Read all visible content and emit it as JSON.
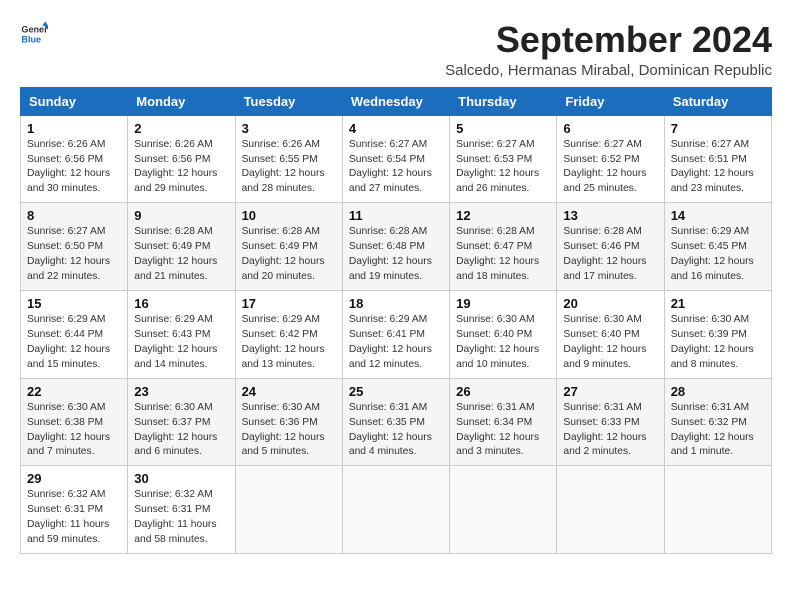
{
  "logo": {
    "line1": "General",
    "line2": "Blue"
  },
  "title": "September 2024",
  "subtitle": "Salcedo, Hermanas Mirabal, Dominican Republic",
  "headers": [
    "Sunday",
    "Monday",
    "Tuesday",
    "Wednesday",
    "Thursday",
    "Friday",
    "Saturday"
  ],
  "weeks": [
    [
      {
        "day": "1",
        "text": "Sunrise: 6:26 AM\nSunset: 6:56 PM\nDaylight: 12 hours\nand 30 minutes."
      },
      {
        "day": "2",
        "text": "Sunrise: 6:26 AM\nSunset: 6:56 PM\nDaylight: 12 hours\nand 29 minutes."
      },
      {
        "day": "3",
        "text": "Sunrise: 6:26 AM\nSunset: 6:55 PM\nDaylight: 12 hours\nand 28 minutes."
      },
      {
        "day": "4",
        "text": "Sunrise: 6:27 AM\nSunset: 6:54 PM\nDaylight: 12 hours\nand 27 minutes."
      },
      {
        "day": "5",
        "text": "Sunrise: 6:27 AM\nSunset: 6:53 PM\nDaylight: 12 hours\nand 26 minutes."
      },
      {
        "day": "6",
        "text": "Sunrise: 6:27 AM\nSunset: 6:52 PM\nDaylight: 12 hours\nand 25 minutes."
      },
      {
        "day": "7",
        "text": "Sunrise: 6:27 AM\nSunset: 6:51 PM\nDaylight: 12 hours\nand 23 minutes."
      }
    ],
    [
      {
        "day": "8",
        "text": "Sunrise: 6:27 AM\nSunset: 6:50 PM\nDaylight: 12 hours\nand 22 minutes."
      },
      {
        "day": "9",
        "text": "Sunrise: 6:28 AM\nSunset: 6:49 PM\nDaylight: 12 hours\nand 21 minutes."
      },
      {
        "day": "10",
        "text": "Sunrise: 6:28 AM\nSunset: 6:49 PM\nDaylight: 12 hours\nand 20 minutes."
      },
      {
        "day": "11",
        "text": "Sunrise: 6:28 AM\nSunset: 6:48 PM\nDaylight: 12 hours\nand 19 minutes."
      },
      {
        "day": "12",
        "text": "Sunrise: 6:28 AM\nSunset: 6:47 PM\nDaylight: 12 hours\nand 18 minutes."
      },
      {
        "day": "13",
        "text": "Sunrise: 6:28 AM\nSunset: 6:46 PM\nDaylight: 12 hours\nand 17 minutes."
      },
      {
        "day": "14",
        "text": "Sunrise: 6:29 AM\nSunset: 6:45 PM\nDaylight: 12 hours\nand 16 minutes."
      }
    ],
    [
      {
        "day": "15",
        "text": "Sunrise: 6:29 AM\nSunset: 6:44 PM\nDaylight: 12 hours\nand 15 minutes."
      },
      {
        "day": "16",
        "text": "Sunrise: 6:29 AM\nSunset: 6:43 PM\nDaylight: 12 hours\nand 14 minutes."
      },
      {
        "day": "17",
        "text": "Sunrise: 6:29 AM\nSunset: 6:42 PM\nDaylight: 12 hours\nand 13 minutes."
      },
      {
        "day": "18",
        "text": "Sunrise: 6:29 AM\nSunset: 6:41 PM\nDaylight: 12 hours\nand 12 minutes."
      },
      {
        "day": "19",
        "text": "Sunrise: 6:30 AM\nSunset: 6:40 PM\nDaylight: 12 hours\nand 10 minutes."
      },
      {
        "day": "20",
        "text": "Sunrise: 6:30 AM\nSunset: 6:40 PM\nDaylight: 12 hours\nand 9 minutes."
      },
      {
        "day": "21",
        "text": "Sunrise: 6:30 AM\nSunset: 6:39 PM\nDaylight: 12 hours\nand 8 minutes."
      }
    ],
    [
      {
        "day": "22",
        "text": "Sunrise: 6:30 AM\nSunset: 6:38 PM\nDaylight: 12 hours\nand 7 minutes."
      },
      {
        "day": "23",
        "text": "Sunrise: 6:30 AM\nSunset: 6:37 PM\nDaylight: 12 hours\nand 6 minutes."
      },
      {
        "day": "24",
        "text": "Sunrise: 6:30 AM\nSunset: 6:36 PM\nDaylight: 12 hours\nand 5 minutes."
      },
      {
        "day": "25",
        "text": "Sunrise: 6:31 AM\nSunset: 6:35 PM\nDaylight: 12 hours\nand 4 minutes."
      },
      {
        "day": "26",
        "text": "Sunrise: 6:31 AM\nSunset: 6:34 PM\nDaylight: 12 hours\nand 3 minutes."
      },
      {
        "day": "27",
        "text": "Sunrise: 6:31 AM\nSunset: 6:33 PM\nDaylight: 12 hours\nand 2 minutes."
      },
      {
        "day": "28",
        "text": "Sunrise: 6:31 AM\nSunset: 6:32 PM\nDaylight: 12 hours\nand 1 minute."
      }
    ],
    [
      {
        "day": "29",
        "text": "Sunrise: 6:32 AM\nSunset: 6:31 PM\nDaylight: 11 hours\nand 59 minutes."
      },
      {
        "day": "30",
        "text": "Sunrise: 6:32 AM\nSunset: 6:31 PM\nDaylight: 11 hours\nand 58 minutes."
      },
      {
        "day": "",
        "text": ""
      },
      {
        "day": "",
        "text": ""
      },
      {
        "day": "",
        "text": ""
      },
      {
        "day": "",
        "text": ""
      },
      {
        "day": "",
        "text": ""
      }
    ]
  ]
}
